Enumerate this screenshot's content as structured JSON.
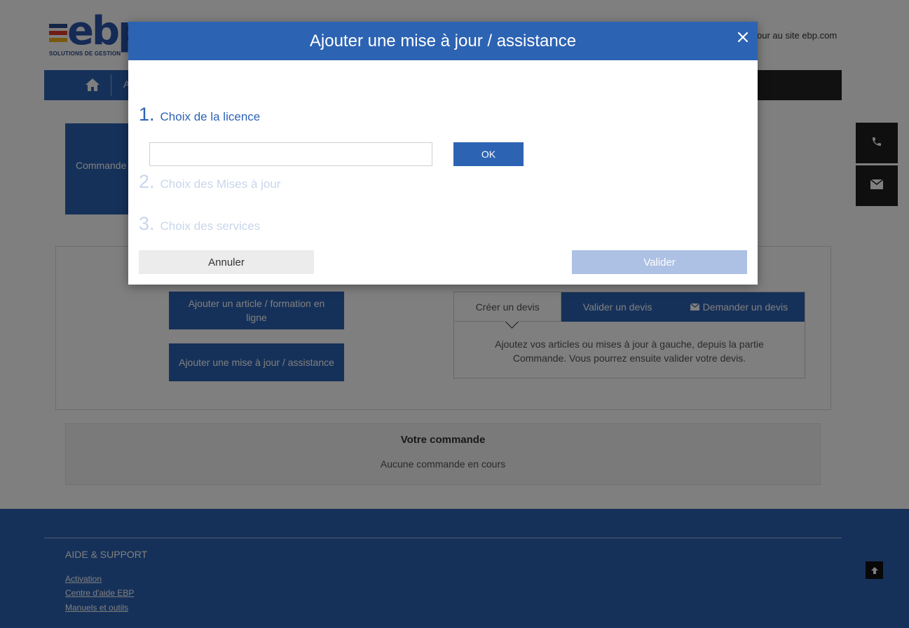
{
  "header": {
    "logo_word": "ebp",
    "logo_tagline": "SOLUTIONS DE GESTION",
    "back_link": "our au site ebp.com"
  },
  "nav": {
    "first_item": "A"
  },
  "order_tile": {
    "label": "Commande"
  },
  "catalog": {
    "add_article_label": "Ajouter un article / formation en ligne",
    "add_update_label": "Ajouter une mise à jour / assistance"
  },
  "quote": {
    "tabs": [
      {
        "label": "Créer un devis"
      },
      {
        "label": "Valider un devis"
      },
      {
        "label": "Demander un devis"
      }
    ],
    "description": "Ajoutez vos articles ou mises à jour à gauche, depuis la partie Commande. Vous pourrez ensuite valider votre devis."
  },
  "cart": {
    "title": "Votre commande",
    "empty_text": "Aucune commande en cours"
  },
  "footer": {
    "section_title": "AIDE & SUPPORT",
    "links": [
      {
        "label": "Activation"
      },
      {
        "label": "Centre d'aide EBP"
      },
      {
        "label": "Manuels et outils"
      }
    ]
  },
  "modal": {
    "title": "Ajouter une mise à jour / assistance",
    "steps": [
      {
        "number": "1.",
        "label": "Choix de la licence"
      },
      {
        "number": "2.",
        "label": "Choix des Mises à jour"
      },
      {
        "number": "3.",
        "label": "Choix des services"
      }
    ],
    "licence_input_value": "",
    "ok_label": "OK",
    "cancel_label": "Annuler",
    "validate_label": "Valider"
  },
  "icons": {
    "home": "home-icon",
    "phone": "phone-icon",
    "mail": "envelope-icon",
    "close": "close-icon",
    "up": "arrow-up-icon"
  },
  "colors": {
    "brand_blue": "#2d63b3",
    "dark_nav": "#222222",
    "disabled_blue": "#adc1e4",
    "logo_bars": [
      "#2a4a8a",
      "#e03a2a",
      "#f2b01e"
    ]
  }
}
